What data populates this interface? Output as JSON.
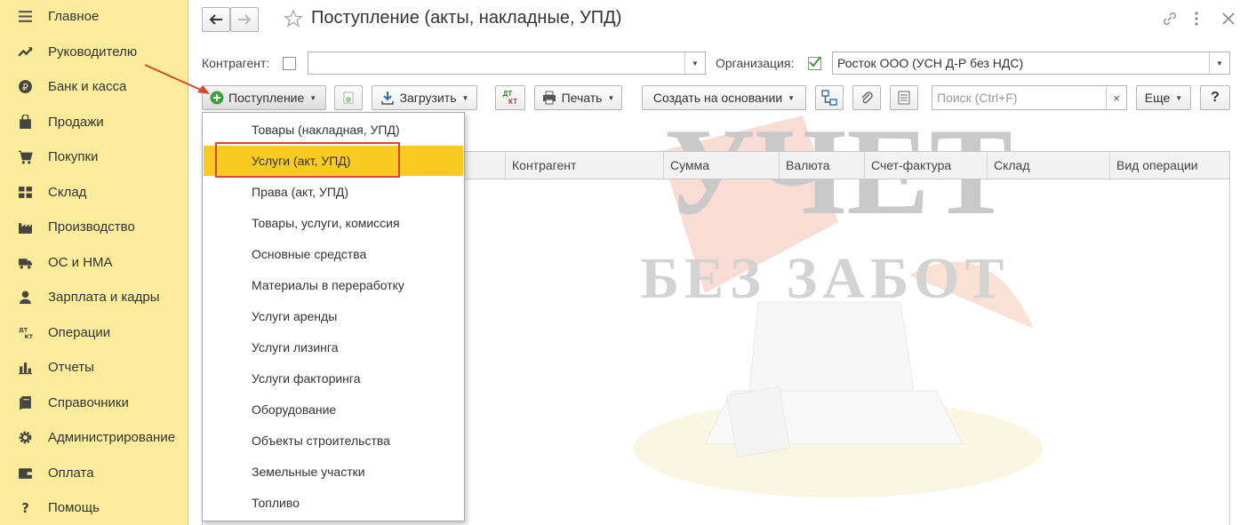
{
  "sidebar": {
    "items": [
      {
        "label": "Главное",
        "icon": "menu-lines-icon"
      },
      {
        "label": "Руководителю",
        "icon": "trend-chart-icon"
      },
      {
        "label": "Банк и касса",
        "icon": "ruble-coin-icon"
      },
      {
        "label": "Продажи",
        "icon": "shopping-bag-icon"
      },
      {
        "label": "Покупки",
        "icon": "cart-icon"
      },
      {
        "label": "Склад",
        "icon": "warehouse-boxes-icon"
      },
      {
        "label": "Производство",
        "icon": "factory-icon"
      },
      {
        "label": "ОС и НМА",
        "icon": "truck-icon"
      },
      {
        "label": "Зарплата и кадры",
        "icon": "person-icon"
      },
      {
        "label": "Операции",
        "icon": "dt-kt-icon"
      },
      {
        "label": "Отчеты",
        "icon": "bar-chart-icon"
      },
      {
        "label": "Справочники",
        "icon": "book-icon"
      },
      {
        "label": "Администрирование",
        "icon": "gear-icon"
      },
      {
        "label": "Оплата",
        "icon": "wallet-icon"
      },
      {
        "label": "Помощь",
        "icon": "question-icon"
      }
    ],
    "bg_color": "#fbec9c"
  },
  "header": {
    "title": "Поступление (акты, накладные, УПД)"
  },
  "filters": {
    "counterparty_label": "Контрагент:",
    "counterparty_value": "",
    "organization_label": "Организация:",
    "organization_value": "Росток ООО (УСН Д-Р без НДС)"
  },
  "toolbar": {
    "receipt_label": "Поступление",
    "load_label": "Загрузить",
    "dt_top": "ДТ",
    "dt_bottom": "КТ",
    "print_label": "Печать",
    "create_based_label": "Создать на основании",
    "search_placeholder": "Поиск (Ctrl+F)",
    "clear_glyph": "×",
    "more_label": "Еще",
    "help_label": "?"
  },
  "table": {
    "columns": [
      "Контрагент",
      "Сумма",
      "Валюта",
      "Счет-фактура",
      "Склад",
      "Вид операции"
    ]
  },
  "menu": {
    "items": [
      "Товары (накладная, УПД)",
      "Услуги (акт, УПД)",
      "Права (акт, УПД)",
      "Товары, услуги, комиссия",
      "Основные средства",
      "Материалы в переработку",
      "Услуги аренды",
      "Услуги лизинга",
      "Услуги факторинга",
      "Оборудование",
      "Объекты строительства",
      "Земельные участки",
      "Топливо"
    ],
    "highlighted_index": 1,
    "highlight_color": "#f9cb20"
  },
  "watermark": {
    "line1": "УЧЕТ",
    "line2": "БЕЗ ЗАБОТ"
  },
  "colors": {
    "accent_green": "#3aa33a",
    "annotation_red": "#d9452f"
  }
}
